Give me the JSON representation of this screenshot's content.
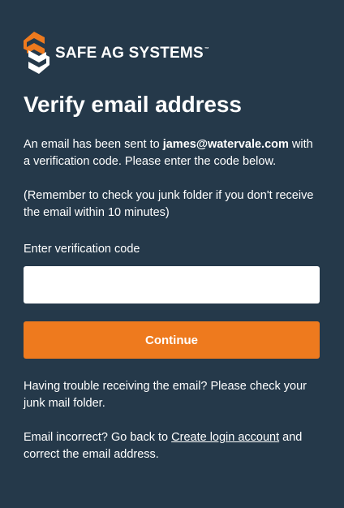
{
  "brand": {
    "name": "SAFE AG SYSTEMS",
    "trademark": "™",
    "colors": {
      "background": "#25394a",
      "accent": "#ee7a1e",
      "text": "#ffffff"
    }
  },
  "page": {
    "title": "Verify email address"
  },
  "intro": {
    "line_start": "An email has been sent to ",
    "email": "james@watervale.com",
    "line_end": " with a verification code. Please enter the code below."
  },
  "reminder": {
    "text": "(Remember to check you junk folder if you don't receive the email within 10 minutes)"
  },
  "form": {
    "code_label": "Enter verification code",
    "code_value": "",
    "code_placeholder": "",
    "continue_label": "Continue"
  },
  "help": {
    "trouble_text": "Having trouble receiving the email? Please check your junk mail folder.",
    "incorrect_start": "Email incorrect? Go back to ",
    "incorrect_link": "Create login account",
    "incorrect_end": " and correct the email address."
  },
  "icons": {
    "logo": "safe-ag-logo-icon"
  }
}
